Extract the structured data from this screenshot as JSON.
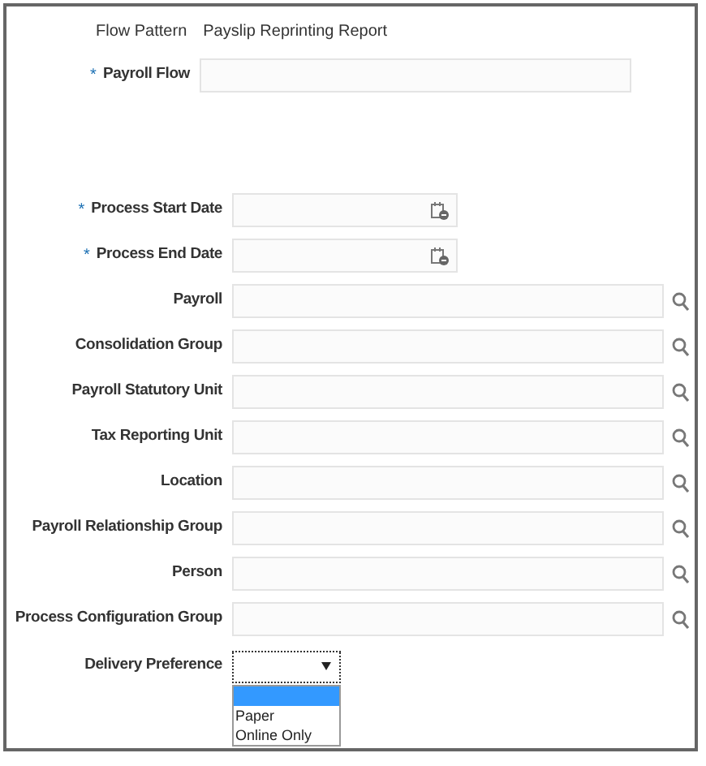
{
  "flow_pattern": {
    "label": "Flow Pattern",
    "value": "Payslip Reprinting Report"
  },
  "payroll_flow": {
    "label": "Payroll Flow",
    "required_mark": "*"
  },
  "fields": [
    {
      "label": "Process Start Date",
      "required_mark": "*",
      "kind": "date"
    },
    {
      "label": "Process End Date",
      "required_mark": "*",
      "kind": "date"
    },
    {
      "label": "Payroll",
      "kind": "lookup"
    },
    {
      "label": "Consolidation Group",
      "kind": "lookup"
    },
    {
      "label": "Payroll Statutory Unit",
      "kind": "lookup"
    },
    {
      "label": "Tax Reporting Unit",
      "kind": "lookup"
    },
    {
      "label": "Location",
      "kind": "lookup"
    },
    {
      "label": "Payroll Relationship Group",
      "kind": "lookup"
    },
    {
      "label": "Person",
      "kind": "lookup"
    },
    {
      "label": "Process Configuration Group",
      "kind": "lookup"
    }
  ],
  "delivery_preference": {
    "label": "Delivery Preference",
    "expanded": true,
    "options": [
      {
        "kind": "blank",
        "selected": true
      },
      {
        "kind": "text",
        "label": "Paper",
        "selected": false
      },
      {
        "kind": "text",
        "label": "Online Only",
        "selected": false
      }
    ]
  }
}
